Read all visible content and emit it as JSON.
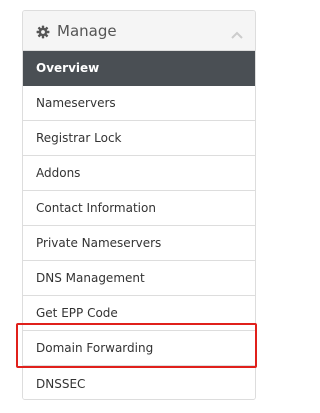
{
  "panel": {
    "title": "Manage",
    "header_icon": "gear-icon",
    "collapse_icon": "chevron-up-icon",
    "items": [
      {
        "label": "Overview",
        "active": true
      },
      {
        "label": "Nameservers"
      },
      {
        "label": "Registrar Lock"
      },
      {
        "label": "Addons"
      },
      {
        "label": "Contact Information"
      },
      {
        "label": "Private Nameservers"
      },
      {
        "label": "DNS Management"
      },
      {
        "label": "Get EPP Code"
      },
      {
        "label": "Domain Forwarding",
        "highlighted": true
      },
      {
        "label": "DNSSEC"
      }
    ]
  },
  "colors": {
    "active_bg": "#4a4f54",
    "highlight_border": "#e0201b",
    "header_bg": "#f5f5f5"
  }
}
